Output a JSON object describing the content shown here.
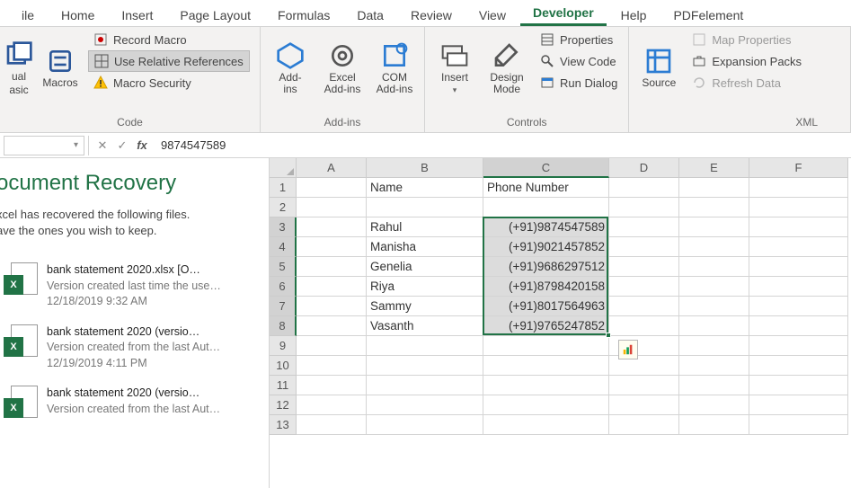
{
  "tabs": [
    "ile",
    "Home",
    "Insert",
    "Page Layout",
    "Formulas",
    "Data",
    "Review",
    "View",
    "Developer",
    "Help",
    "PDFelement"
  ],
  "active_tab": "Developer",
  "ribbon": {
    "code": {
      "visual_basic_top": "ual",
      "visual_basic_bottom": "asic",
      "macros": "Macros",
      "record_macro": "Record Macro",
      "use_relative": "Use Relative References",
      "macro_security": "Macro Security",
      "label": "Code"
    },
    "addins": {
      "addins": "Add-\nins",
      "excel_addins": "Excel\nAdd-ins",
      "com_addins": "COM\nAdd-ins",
      "label": "Add-ins"
    },
    "controls": {
      "insert": "Insert",
      "design_mode": "Design\nMode",
      "properties": "Properties",
      "view_code": "View Code",
      "run_dialog": "Run Dialog",
      "label": "Controls"
    },
    "xml": {
      "source": "Source",
      "map_properties": "Map Properties",
      "expansion_packs": "Expansion Packs",
      "refresh_data": "Refresh Data",
      "label": "XML"
    }
  },
  "formula_bar": {
    "name_box": "",
    "value": "9874547589"
  },
  "recovery": {
    "title": "ocument Recovery",
    "sub1": "xcel has recovered the following files.",
    "sub2": "ave the ones you wish to keep.",
    "items": [
      {
        "title": "bank statement 2020.xlsx  [O…",
        "sub": "Version created last time the use…",
        "time": "12/18/2019 9:32 AM"
      },
      {
        "title": "bank statement 2020 (versio…",
        "sub": "Version created from the last Aut…",
        "time": "12/19/2019 4:11 PM"
      },
      {
        "title": "bank statement 2020 (versio…",
        "sub": "Version created from the last Aut…",
        "time": ""
      }
    ]
  },
  "grid": {
    "columns": [
      "A",
      "B",
      "C",
      "D",
      "E",
      "F"
    ],
    "headers": {
      "B1": "Name",
      "C1": "Phone Number"
    },
    "data": [
      {
        "name": "Rahul",
        "phone": "(+91)9874547589"
      },
      {
        "name": "Manisha",
        "phone": "(+91)9021457852"
      },
      {
        "name": "Genelia",
        "phone": "(+91)9686297512"
      },
      {
        "name": "Riya",
        "phone": "(+91)8798420158"
      },
      {
        "name": "Sammy",
        "phone": "(+91)8017564963"
      },
      {
        "name": "Vasanth",
        "phone": "(+91)9765247852"
      }
    ],
    "selected": {
      "col": "C",
      "rows": [
        3,
        8
      ]
    }
  },
  "chart_data": {
    "type": "table",
    "title": "",
    "columns": [
      "Name",
      "Phone Number"
    ],
    "rows": [
      [
        "Rahul",
        "(+91)9874547589"
      ],
      [
        "Manisha",
        "(+91)9021457852"
      ],
      [
        "Genelia",
        "(+91)9686297512"
      ],
      [
        "Riya",
        "(+91)8798420158"
      ],
      [
        "Sammy",
        "(+91)8017564963"
      ],
      [
        "Vasanth",
        "(+91)9765247852"
      ]
    ]
  }
}
